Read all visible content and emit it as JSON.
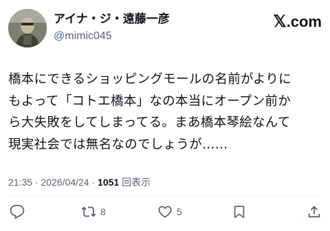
{
  "author": {
    "display_name": "アイナ・ジ・遠藤一彦",
    "handle": "@mimic045",
    "avatar_icon": "user-avatar"
  },
  "brand": {
    "mark": "𝕏",
    "suffix": ".com"
  },
  "post": {
    "text": "橋本にできるショッピングモールの名前がよりに\nもよって「コトエ橋本」なの本当にオープン前か\nら大失敗をしてしまってる。まあ橋本琴絵なんて\n現実社会では無名なのでしょうが……"
  },
  "meta": {
    "time": "21:35",
    "separator": " · ",
    "date": "2026/04/24",
    "separator2": " · ",
    "views_count": "1051",
    "views_label": " 回表示"
  },
  "actions": {
    "reply": {
      "icon": "reply-icon",
      "count": ""
    },
    "repost": {
      "icon": "repost-icon",
      "count": "8"
    },
    "like": {
      "icon": "heart-icon",
      "count": "5"
    },
    "bookmark": {
      "icon": "bookmark-icon",
      "count": ""
    },
    "share": {
      "icon": "share-icon",
      "count": ""
    }
  },
  "colors": {
    "text": "#0f1419",
    "secondary": "#536471",
    "divider": "#eff3f4"
  }
}
